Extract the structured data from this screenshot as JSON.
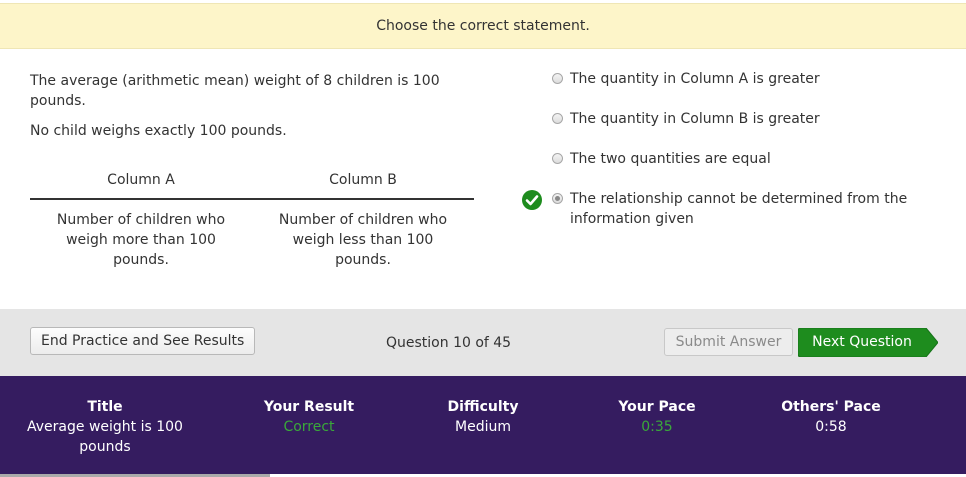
{
  "instruction": "Choose the correct statement.",
  "question": {
    "stem_lines": [
      "The average (arithmetic mean) weight of 8 children is 100 pounds.",
      "No child weighs exactly 100 pounds."
    ],
    "column_a_header": "Column A",
    "column_b_header": "Column B",
    "column_a_text": "Number of children who weigh more than 100 pounds.",
    "column_b_text": "Number of children who weigh less than 100 pounds."
  },
  "options": [
    {
      "label": "The quantity in Column A is greater",
      "selected": false,
      "correct": false
    },
    {
      "label": "The quantity in Column B is greater",
      "selected": false,
      "correct": false
    },
    {
      "label": "The two quantities are equal",
      "selected": false,
      "correct": false
    },
    {
      "label": "The relationship cannot be determined from the information given",
      "selected": true,
      "correct": true
    }
  ],
  "actions": {
    "end_label": "End Practice and See Results",
    "question_counter": "Question 10 of 45",
    "submit_label": "Submit Answer",
    "next_label": "Next Question"
  },
  "stats": {
    "title_label": "Title",
    "title_value": "Average weight is 100 pounds",
    "result_label": "Your Result",
    "result_value": "Correct",
    "difficulty_label": "Difficulty",
    "difficulty_value": "Medium",
    "pace_label": "Your Pace",
    "pace_value": "0:35",
    "others_label": "Others' Pace",
    "others_value": "0:58"
  },
  "colors": {
    "banner_bg": "#fdf5c9",
    "footer_bg": "#351c60",
    "correct_green": "#1e8c1e",
    "next_button_green": "#1e8c1e"
  }
}
